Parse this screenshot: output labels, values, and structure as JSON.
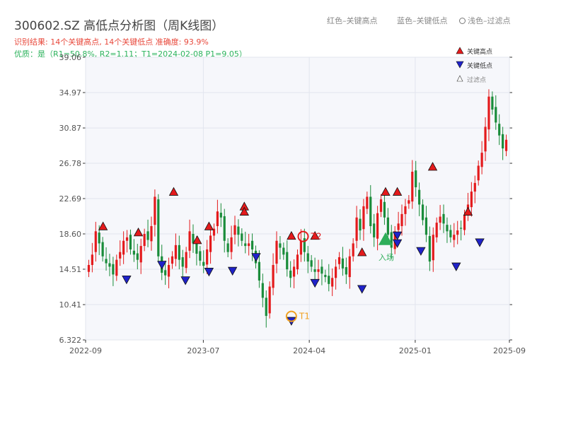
{
  "header": {
    "title": "300602.SZ 高低点分析图（周K线图）",
    "result_line": "识别结果: 14个关键高点, 14个关键低点  准确度: 93.9%",
    "quality_line": "优质：是（R1=50.8%, R2=1.11；T1=2024-02-08 P1=9.05）",
    "legend_red": "红色–关键高点",
    "legend_blue": "蓝色–关键低点",
    "legend_light": "浅色–过滤点"
  },
  "chart_data": {
    "type": "candlestick",
    "title": "300602.SZ 高低点分析图（周K线图）",
    "y_ticks": [
      "39.06",
      "34.97",
      "30.87",
      "26.78",
      "22.69",
      "18.60",
      "14.51",
      "10.41",
      "6.322"
    ],
    "ylim": [
      6.322,
      39.06
    ],
    "x_ticks": [
      "2022-09",
      "2023-07",
      "2024-04",
      "2025-01",
      "2025-09"
    ],
    "x_range": [
      "2022-09",
      "2025-09"
    ],
    "legend": {
      "position": "top-right",
      "items": [
        "关键高点",
        "关键低点",
        "过滤点"
      ]
    },
    "colors": {
      "up": "#e41a1c",
      "down": "#1a8c3a",
      "high_marker": "#e41a1c",
      "low_marker": "#1f22c9",
      "entry": "#2eae5a",
      "t_marker": "#f0a020"
    },
    "price_path": [
      15.0,
      16.2,
      18.9,
      17.5,
      16.0,
      15.2,
      14.8,
      13.9,
      15.6,
      16.5,
      17.8,
      18.2,
      16.8,
      16.2,
      15.6,
      17.2,
      18.6,
      17.9,
      19.5,
      22.9,
      16.0,
      14.1,
      13.8,
      15.0,
      16.0,
      17.3,
      15.6,
      14.8,
      16.5,
      18.9,
      17.5,
      16.3,
      15.5,
      14.9,
      16.8,
      18.4,
      19.2,
      21.2,
      20.5,
      17.8,
      16.5,
      18.2,
      19.6,
      18.5,
      17.8,
      17.2,
      17.5,
      16.8,
      15.2,
      13.2,
      11.2,
      9.1,
      12.5,
      15.0,
      17.8,
      17.0,
      16.2,
      14.5,
      13.5,
      14.8,
      16.2,
      17.8,
      16.5,
      15.4,
      14.8,
      14.2,
      14.5,
      14.0,
      13.6,
      12.8,
      13.5,
      14.8,
      15.9,
      14.6,
      13.9,
      16.0,
      17.5,
      20.5,
      19.0,
      21.8,
      22.9,
      19.5,
      18.2,
      21.0,
      22.6,
      20.5,
      18.5,
      17.0,
      18.9,
      19.8,
      20.9,
      21.8,
      22.5,
      25.8,
      24.0,
      22.0,
      20.2,
      18.5,
      15.4,
      18.5,
      19.9,
      20.6,
      19.8,
      18.9,
      18.2,
      18.5,
      19.0,
      19.2,
      20.8,
      22.0,
      23.5,
      24.5,
      26.5,
      28.0,
      31.0,
      34.5,
      33.0,
      31.5,
      30.0,
      28.5,
      29.5
    ],
    "key_highs": [
      {
        "date": "2022-10",
        "price": 18.9
      },
      {
        "date": "2023-01",
        "price": 18.2
      },
      {
        "date": "2023-04",
        "price": 22.9
      },
      {
        "date": "2023-06",
        "price": 17.3
      },
      {
        "date": "2023-07",
        "price": 18.9
      },
      {
        "date": "2023-10",
        "price": 21.2
      },
      {
        "date": "2023-10",
        "price": 20.6
      },
      {
        "date": "2024-02",
        "price": 17.8
      },
      {
        "date": "2024-04",
        "price": 17.8
      },
      {
        "date": "2024-08",
        "price": 15.9
      },
      {
        "date": "2024-10",
        "price": 22.9
      },
      {
        "date": "2024-11",
        "price": 22.9
      },
      {
        "date": "2025-02",
        "price": 25.8
      },
      {
        "date": "2025-05",
        "price": 20.6
      }
    ],
    "key_lows": [
      {
        "date": "2022-12",
        "price": 13.9
      },
      {
        "date": "2023-03",
        "price": 15.6
      },
      {
        "date": "2023-05",
        "price": 13.8
      },
      {
        "date": "2023-07",
        "price": 14.8
      },
      {
        "date": "2023-09",
        "price": 14.9
      },
      {
        "date": "2023-11",
        "price": 16.5
      },
      {
        "date": "2024-02",
        "price": 9.1
      },
      {
        "date": "2024-04",
        "price": 13.5
      },
      {
        "date": "2024-08",
        "price": 12.8
      },
      {
        "date": "2024-11",
        "price": 19.0
      },
      {
        "date": "2024-11",
        "price": 18.1
      },
      {
        "date": "2025-01",
        "price": 17.2
      },
      {
        "date": "2025-04",
        "price": 15.4
      },
      {
        "date": "2025-06",
        "price": 18.2
      }
    ],
    "entry": {
      "label": "入场",
      "date": "2024-10",
      "price": 17.8
    },
    "t_points": [
      {
        "label": "T1",
        "date": "2024-02",
        "price": 9.05
      },
      {
        "label": "T2",
        "date": "2024-03",
        "price": 18.3
      }
    ]
  }
}
